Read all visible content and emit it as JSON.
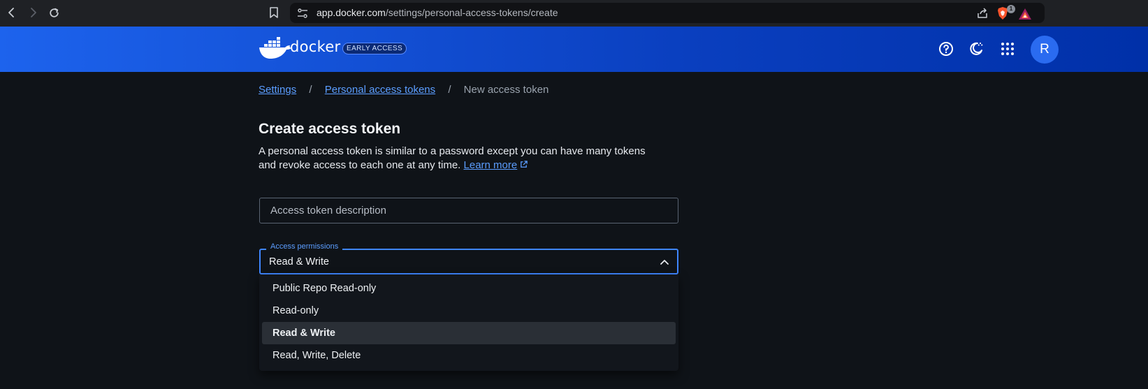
{
  "browser": {
    "url_host": "app.docker.com",
    "url_path": "/settings/personal-access-tokens/create",
    "brave_badge_count": "1",
    "icons": [
      "back-icon",
      "forward-icon",
      "reload-icon",
      "bookmark-icon",
      "site-settings-icon",
      "share-icon",
      "brave-shields-icon",
      "brave-rewards-icon"
    ]
  },
  "header": {
    "logo_text": "docker",
    "badge": "EARLY ACCESS",
    "avatar_initial": "R",
    "icons": [
      "help-icon",
      "theme-toggle-icon",
      "apps-grid-icon"
    ],
    "brand_color": "#1d63ed"
  },
  "breadcrumb": {
    "settings": "Settings",
    "separator": "/",
    "tokens": "Personal access tokens",
    "current": "New access token"
  },
  "page": {
    "title": "Create access token",
    "description_1": "A personal access token is similar to a password except you can have many tokens and revoke access to each one at any time.",
    "learn_more": "Learn more"
  },
  "form": {
    "description_placeholder": "Access token description",
    "permissions_label": "Access permissions",
    "permissions_value": "Read & Write",
    "options": [
      "Public Repo Read-only",
      "Read-only",
      "Read & Write",
      "Read, Write, Delete"
    ],
    "accent_color": "#3f86ff"
  }
}
